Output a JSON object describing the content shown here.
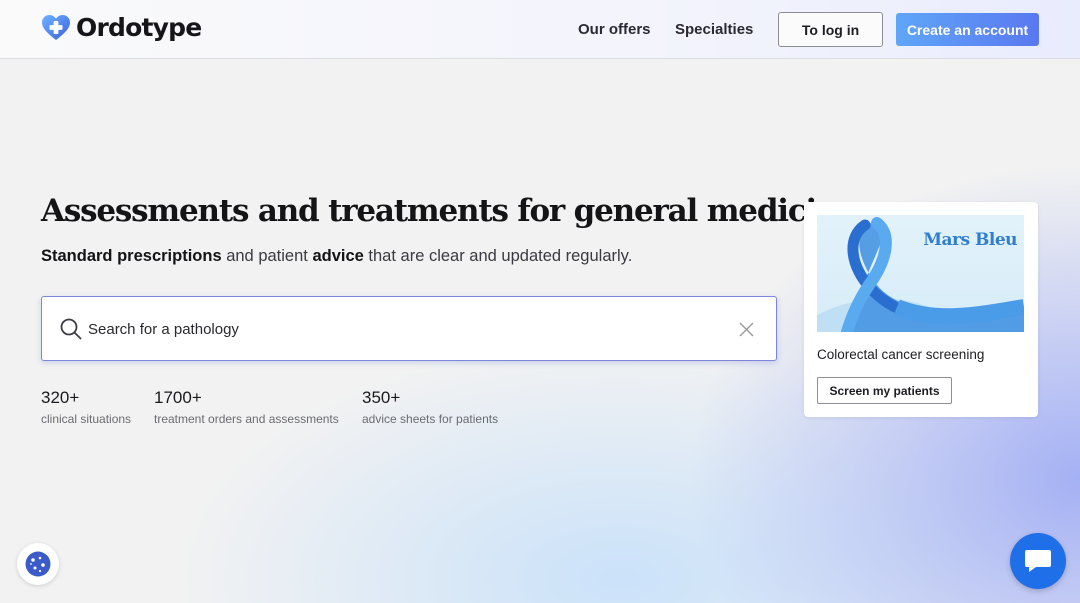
{
  "header": {
    "logo_text": "Ordotype",
    "nav": {
      "offers": "Our offers",
      "specialties": "Specialties"
    },
    "login_label": "To log in",
    "create_account_label": "Create an account"
  },
  "hero": {
    "title": "Assessments and treatments for general medicine.",
    "subtitle": {
      "part1": "Standard prescriptions",
      "part2": " and patient ",
      "part3": "advice",
      "part4": " that are clear and updated regularly."
    },
    "search": {
      "placeholder": "Search for a pathology",
      "value": ""
    },
    "stats": [
      {
        "number": "320+",
        "label": "clinical situations"
      },
      {
        "number": "1700+",
        "label": "treatment orders and assessments"
      },
      {
        "number": "350+",
        "label": "advice sheets for patients"
      }
    ]
  },
  "promo_card": {
    "image_text": "Mars Bleu",
    "caption": "Colorectal cancer screening",
    "button_label": "Screen my patients"
  },
  "icons": {
    "logo": "heart-plus-icon",
    "search": "search-icon",
    "clear": "close-icon",
    "cookie": "cookie-icon",
    "chat": "chat-bubble-icon"
  },
  "colors": {
    "accent": "#5a78f0",
    "accent_light": "#5fa6f8",
    "search_border": "#7e86dc",
    "chat_button": "#1f6fe8",
    "ribbon": "#2f7ed0"
  }
}
